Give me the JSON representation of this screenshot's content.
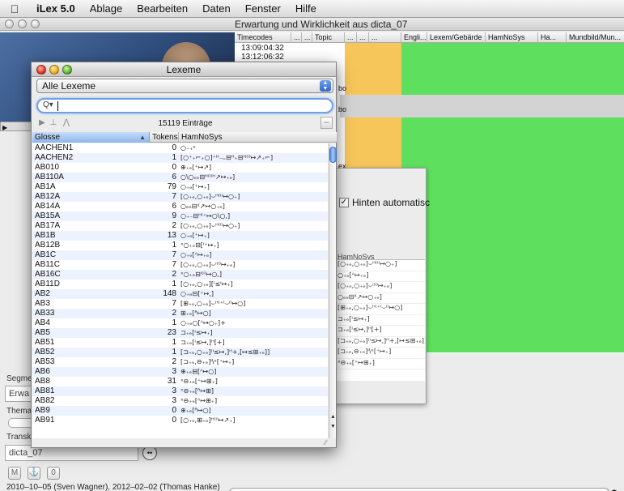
{
  "menubar": {
    "apple": "",
    "app": "iLex 5.0",
    "items": [
      "Ablage",
      "Bearbeiten",
      "Daten",
      "Fenster",
      "Hilfe"
    ]
  },
  "main_window": {
    "title": "Erwartung und Wirklichkeit aus dicta_07",
    "columns": [
      "Timecodes",
      "...",
      "...",
      "Topic",
      "...",
      "...",
      "...",
      "Engli...",
      "Lexem/Gebärde",
      "HamNoSys",
      "Ha...",
      "Mundbild/Mun..."
    ],
    "timecodes": [
      "13:09:04:32",
      "13:12:06:32"
    ],
    "fragments": [
      "bo",
      "bo",
      "ex",
      "Ex"
    ],
    "segment_label": "Segme",
    "segment_value": "Erwa",
    "thema_label": "Thema",
    "transk_label": "Transk",
    "transcript_value": "dicta_07",
    "bottom_buttons": [
      "M",
      "⚓",
      "0"
    ],
    "footer": "2010–10–05 (Sven Wagner), 2012–02–02 (Thomas Hanke)",
    "highlight_colors": {
      "orange": "#f6c65b",
      "green": "#5ee05e",
      "grey": "#d0d0d0"
    }
  },
  "inspector": {
    "checkbox_label": "Hinten automatisc",
    "hamnosys_header": "HamNoSys"
  },
  "lexeme_panel": {
    "title": "Lexeme",
    "filter_selected": "Alle Lexeme",
    "search_placeholder": "",
    "entries_count": "15119 Einträge",
    "columns": {
      "glosse": "Glosse",
      "tokens": "Tokens",
      "hamnosys": "HamNoSys"
    },
    "rows": [
      {
        "glosse": "AACHEN1",
        "tokens": "0",
        "hns": "○₋₊ᵉ"
      },
      {
        "glosse": "AACHEN2",
        "tokens": "1",
        "hns": "[○⁺₊⌐₊○]⁺ᴴ₋₌⊟ᴴ₊⊟ᴴ⁽ᴵ⁾↦↗₊⌐]"
      },
      {
        "glosse": "AB010",
        "tokens": "0",
        "hns": "⊕₊ₑ[⁺↦↗]"
      },
      {
        "glosse": "AB110A",
        "tokens": "6",
        "hns": "○\\○ₑₑ⊟ᴴ⁽ᴵ⁾ᴴ↗↦₊ₑ]"
      },
      {
        "glosse": "AB1A",
        "tokens": "79",
        "hns": "○₊ₑ[⁺↦₊]"
      },
      {
        "glosse": "AB12A",
        "tokens": "7",
        "hns": "[○₊ₑ,○₊ₑ]⌣ᴴ⁽ᴵ⁾↦○₊]"
      },
      {
        "glosse": "AB14A",
        "tokens": "6",
        "hns": "○ₑₑ⊟ᴵ⁽↗↦○₊ₑ]"
      },
      {
        "glosse": "AB15A",
        "tokens": "9",
        "hns": "○₊₋⊟ᴴ⁽⁺↦○\\○,]"
      },
      {
        "glosse": "AB17A",
        "tokens": "2",
        "hns": "[○₊ₑ,○₊ₑ]⌣ᴴ⁽ᴵ⁾↦○₊]"
      },
      {
        "glosse": "AB1B",
        "tokens": "13",
        "hns": "○₊ₑ[⁺↦₊]"
      },
      {
        "glosse": "AB12B",
        "tokens": "1",
        "hns": "ˣ○₊ₑ⊟[ᴵ⁺↦₊]"
      },
      {
        "glosse": "AB1C",
        "tokens": "7",
        "hns": "○₊ₑ[ᴬ↦₊ₑ]"
      },
      {
        "glosse": "AB11C",
        "tokens": "7",
        "hns": "[○₊ₑ,○₊ₑ]⌣ᴵ⁽ᴵ⁾↦₊ₑ]"
      },
      {
        "glosse": "AB16C",
        "tokens": "2",
        "hns": "ˣ○₊ₑ⊟ᴵ⁽ᴵ⁾↦○,]"
      },
      {
        "glosse": "AB11D",
        "tokens": "1",
        "hns": "[○₊ₑ,○₊ₑ][ᴵ≤ᴵ↦₊]"
      },
      {
        "glosse": "AB2",
        "tokens": "148",
        "hns": "○₊ₑ⊟[⁺↦,]"
      },
      {
        "glosse": "AB3",
        "tokens": "7",
        "hns": "[⊞₊ₑ,○₊ₑ]⌣ᴴ⁽⁺⁽⌣ᴵ⁾↦○]"
      },
      {
        "glosse": "AB33",
        "tokens": "2",
        "hns": "⊞₊ₑ[ᴿ↦○]"
      },
      {
        "glosse": "AB4",
        "tokens": "1",
        "hns": "○₊ₑ○[ᴬ↦○₊]+"
      },
      {
        "glosse": "AB5",
        "tokens": "23",
        "hns": "⊐₊ₑ[ᴵ≤↦₊]"
      },
      {
        "glosse": "AB51",
        "tokens": "1",
        "hns": "⊐₊ₑ[ᴵ≤↦,]ᴴ[+]"
      },
      {
        "glosse": "AB52",
        "tokens": "1",
        "hns": "[⊐₊ₑ,○₊ₑ]⁽ᴵ≤↦,]ᴴ+,[↦≤⊞₊ₑ]]"
      },
      {
        "glosse": "AB53",
        "tokens": "2",
        "hns": "[⊐₊ₑ,⊖₊ₑ]ᴵ\\ᵉ[⁺↦₊]"
      },
      {
        "glosse": "AB6",
        "tokens": "3",
        "hns": "⊕₊ₑ⊟[ᴬ↦○]"
      },
      {
        "glosse": "AB8",
        "tokens": "31",
        "hns": "ˣ⊖₊ₑ[⁺↦⊞₊]"
      },
      {
        "glosse": "AB81",
        "tokens": "3",
        "hns": "ˣ⊖₊ₑ[ᴿ↦⊞]"
      },
      {
        "glosse": "AB82",
        "tokens": "3",
        "hns": "ˣ⊖₊ₑ[ᴬ↦⊞₊]"
      },
      {
        "glosse": "AB9",
        "tokens": "0",
        "hns": "⊕₊ₑ[ᴿ↦○]"
      },
      {
        "glosse": "AB91",
        "tokens": "0",
        "hns": "[○₊ₑ,⊞₊ₑ]ᴴ⁽ᴵ⁾↦↗₊]"
      }
    ]
  }
}
